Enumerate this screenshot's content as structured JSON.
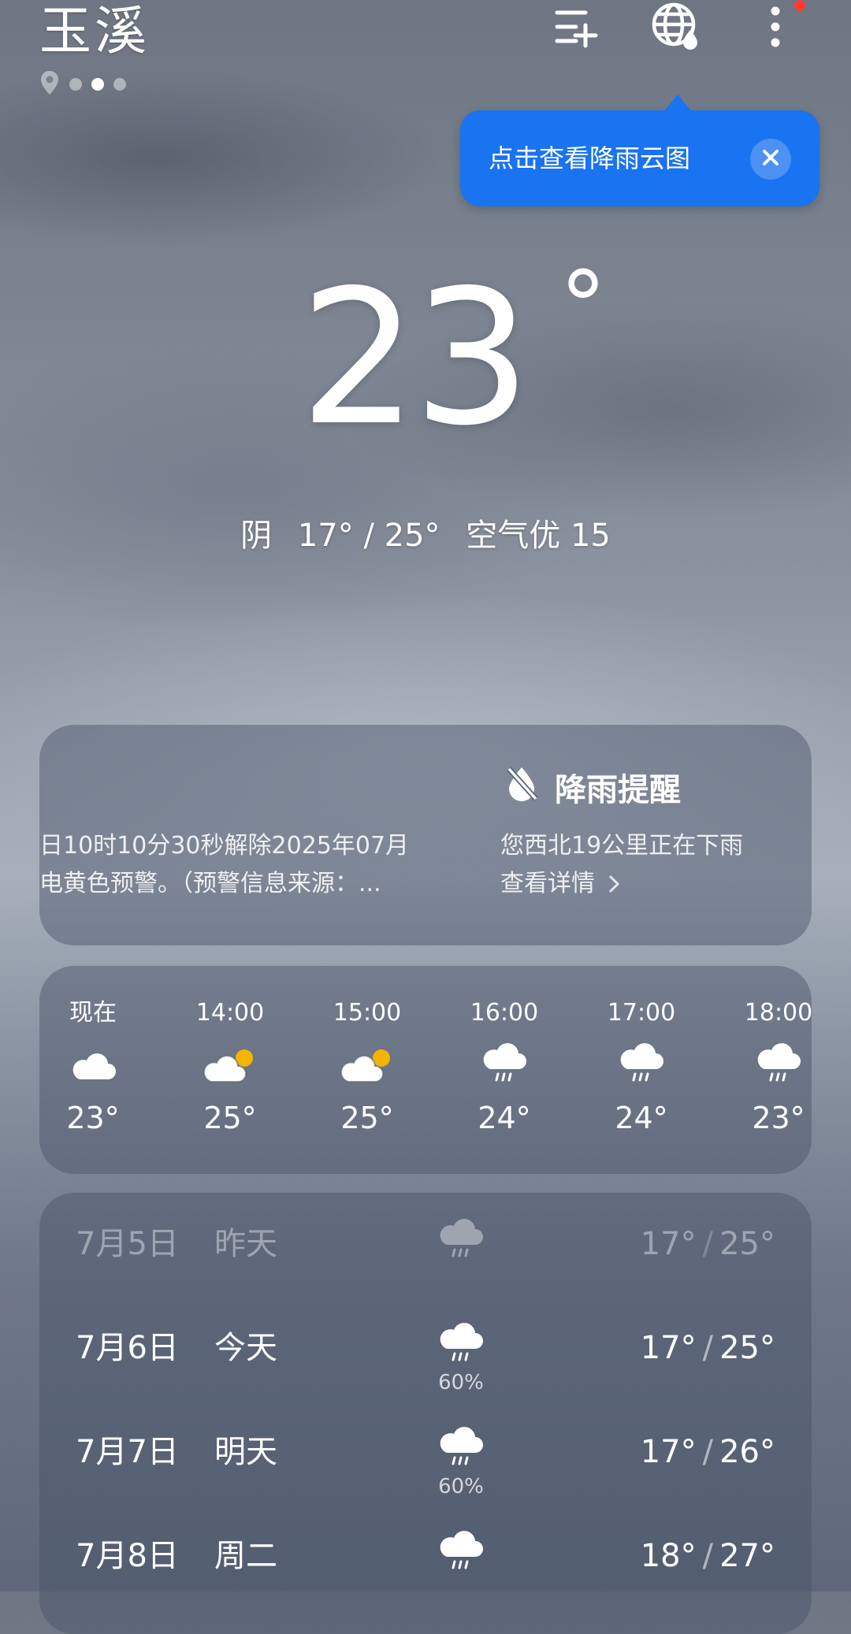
{
  "header": {
    "city": "玉溪",
    "page_dots": 3,
    "active_dot": 1
  },
  "tooltip": {
    "text": "点击查看降雨云图"
  },
  "current": {
    "temp": "23",
    "degree_symbol": "°",
    "condition": "阴",
    "range": "17° / 25°",
    "air_quality": "空气优 15"
  },
  "alerts": {
    "warning_line1": "日10时10分30秒解除2025年07月",
    "warning_line2": "电黄色预警。（预警信息来源：...",
    "rain_title": "降雨提醒",
    "rain_desc": "您西北19公里正在下雨",
    "rain_link": "查看详情"
  },
  "hourly": [
    {
      "time": "现在",
      "icon": "cloud-icon",
      "temp": "23°"
    },
    {
      "time": "14:00",
      "icon": "partly-cloudy-icon",
      "temp": "25°"
    },
    {
      "time": "15:00",
      "icon": "partly-cloudy-icon",
      "temp": "25°"
    },
    {
      "time": "16:00",
      "icon": "rain-cloud-icon",
      "temp": "24°"
    },
    {
      "time": "17:00",
      "icon": "rain-cloud-icon",
      "temp": "24°"
    },
    {
      "time": "18:00",
      "icon": "rain-cloud-icon",
      "temp": "23°"
    }
  ],
  "daily": [
    {
      "date": "7月5日",
      "day": "昨天",
      "icon": "rain-cloud-icon",
      "pct": "",
      "low": "17°",
      "high": "25°",
      "past": true
    },
    {
      "date": "7月6日",
      "day": "今天",
      "icon": "rain-cloud-icon",
      "pct": "60%",
      "low": "17°",
      "high": "25°",
      "past": false
    },
    {
      "date": "7月7日",
      "day": "明天",
      "icon": "rain-cloud-icon",
      "pct": "60%",
      "low": "17°",
      "high": "26°",
      "past": false
    },
    {
      "date": "7月8日",
      "day": "周二",
      "icon": "rain-cloud-icon",
      "pct": "",
      "low": "18°",
      "high": "27°",
      "past": false
    }
  ],
  "colors": {
    "accent": "#1a73f0",
    "sun": "#f5b400",
    "badge": "#ff3b30"
  }
}
